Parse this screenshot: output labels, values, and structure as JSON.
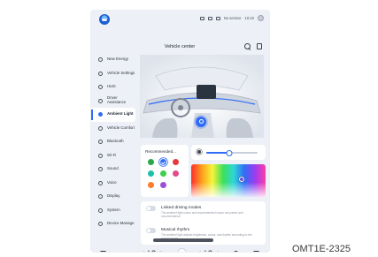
{
  "status_bar": {
    "signal_text": "No service",
    "time": "10:10",
    "icons": [
      "logo-icon",
      "bluetooth-icon",
      "wifi-icon",
      "signal-icon",
      "avatar-icon"
    ]
  },
  "header": {
    "title": "Vehicle center"
  },
  "sidebar": {
    "items": [
      {
        "label": "New Energy",
        "icon": "energy-icon"
      },
      {
        "label": "Vehicle Settings",
        "icon": "car-icon"
      },
      {
        "label": "HUD",
        "icon": "hud-icon"
      },
      {
        "label": "Driver Assistance",
        "icon": "steering-icon"
      },
      {
        "label": "Ambient Light",
        "icon": "bulb-icon",
        "active": true
      },
      {
        "label": "Vehicle Comfort",
        "icon": "seat-icon"
      },
      {
        "label": "Bluetooth",
        "icon": "bluetooth-icon"
      },
      {
        "label": "Wi-Fi",
        "icon": "wifi-icon"
      },
      {
        "label": "Sound",
        "icon": "speaker-icon"
      },
      {
        "label": "Voice",
        "icon": "mic-icon"
      },
      {
        "label": "Display",
        "icon": "sun-icon"
      },
      {
        "label": "System",
        "icon": "gear-icon"
      },
      {
        "label": "Device Manage",
        "icon": "device-icon"
      }
    ]
  },
  "ambient": {
    "recommended_title": "Recommended...",
    "swatches": [
      {
        "color": "#2aa84a"
      },
      {
        "color": "#2f6df6",
        "selected": true
      },
      {
        "color": "#e8383d"
      },
      {
        "color": "#1fbfae"
      },
      {
        "color": "#3ccf4e"
      },
      {
        "color": "#e24a8a"
      },
      {
        "color": "#ff7a29"
      },
      {
        "color": "#9b4fd9"
      }
    ],
    "brightness": 0.45,
    "picker_hue": 0.68,
    "picker_light": 0.45,
    "modes": [
      {
        "title": "Linked driving modes",
        "desc": "The ambient light colour and recommended colour are paired and unconventional",
        "enabled": false
      },
      {
        "title": "Musical rhythm",
        "desc": "The ambient light adjusts brightness, colour, and rhythm according to the sound source",
        "enabled": false
      }
    ]
  },
  "dock": {
    "left_temp": "LO",
    "right_temp": "LO"
  },
  "reference_code": "OMT1E-2325",
  "colors": {
    "accent": "#2f6df6",
    "panel": "#edf0f6",
    "card": "#ffffff"
  }
}
